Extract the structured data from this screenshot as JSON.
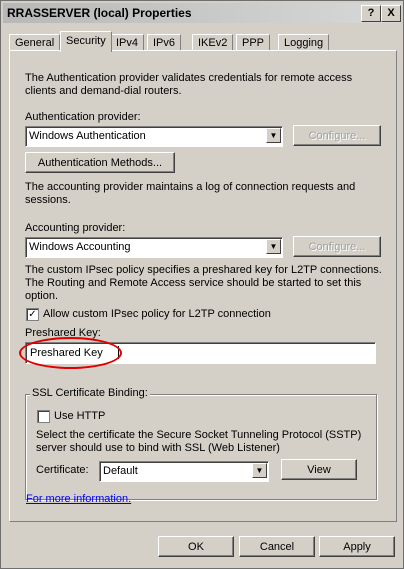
{
  "window": {
    "title": "RRASSERVER (local) Properties",
    "help_btn": "?",
    "close_btn": "X"
  },
  "tabs": [
    "General",
    "Security",
    "IPv4",
    "IPv6",
    "IKEv2",
    "PPP",
    "Logging"
  ],
  "active_tab": "Security",
  "security": {
    "auth_desc": "The Authentication provider validates credentials for remote access clients and demand-dial routers.",
    "auth_provider_label": "Authentication provider:",
    "auth_provider_value": "Windows Authentication",
    "auth_configure": "Configure...",
    "auth_methods_btn": "Authentication Methods...",
    "acct_desc": "The accounting provider maintains a log of connection requests and sessions.",
    "acct_provider_label": "Accounting provider:",
    "acct_provider_value": "Windows Accounting",
    "acct_configure": "Configure...",
    "ipsec_desc": "The custom IPsec policy specifies a preshared key for L2TP connections. The Routing and Remote Access service should be started to set this option.",
    "ipsec_checkbox_label": "Allow custom IPsec policy for L2TP connection",
    "ipsec_checked": true,
    "preshared_label": "Preshared Key:",
    "preshared_value": "Preshared Key",
    "ssl_group_title": "SSL Certificate Binding:",
    "use_http_label": "Use HTTP",
    "use_http_checked": false,
    "ssl_desc": "Select the certificate the Secure Socket Tunneling Protocol (SSTP) server should use to bind with SSL (Web Listener)",
    "cert_label": "Certificate:",
    "cert_value": "Default",
    "view_btn": "View",
    "more_info_link": "For more information."
  },
  "footer": {
    "ok": "OK",
    "cancel": "Cancel",
    "apply": "Apply"
  },
  "annotation_color": "#e00000"
}
